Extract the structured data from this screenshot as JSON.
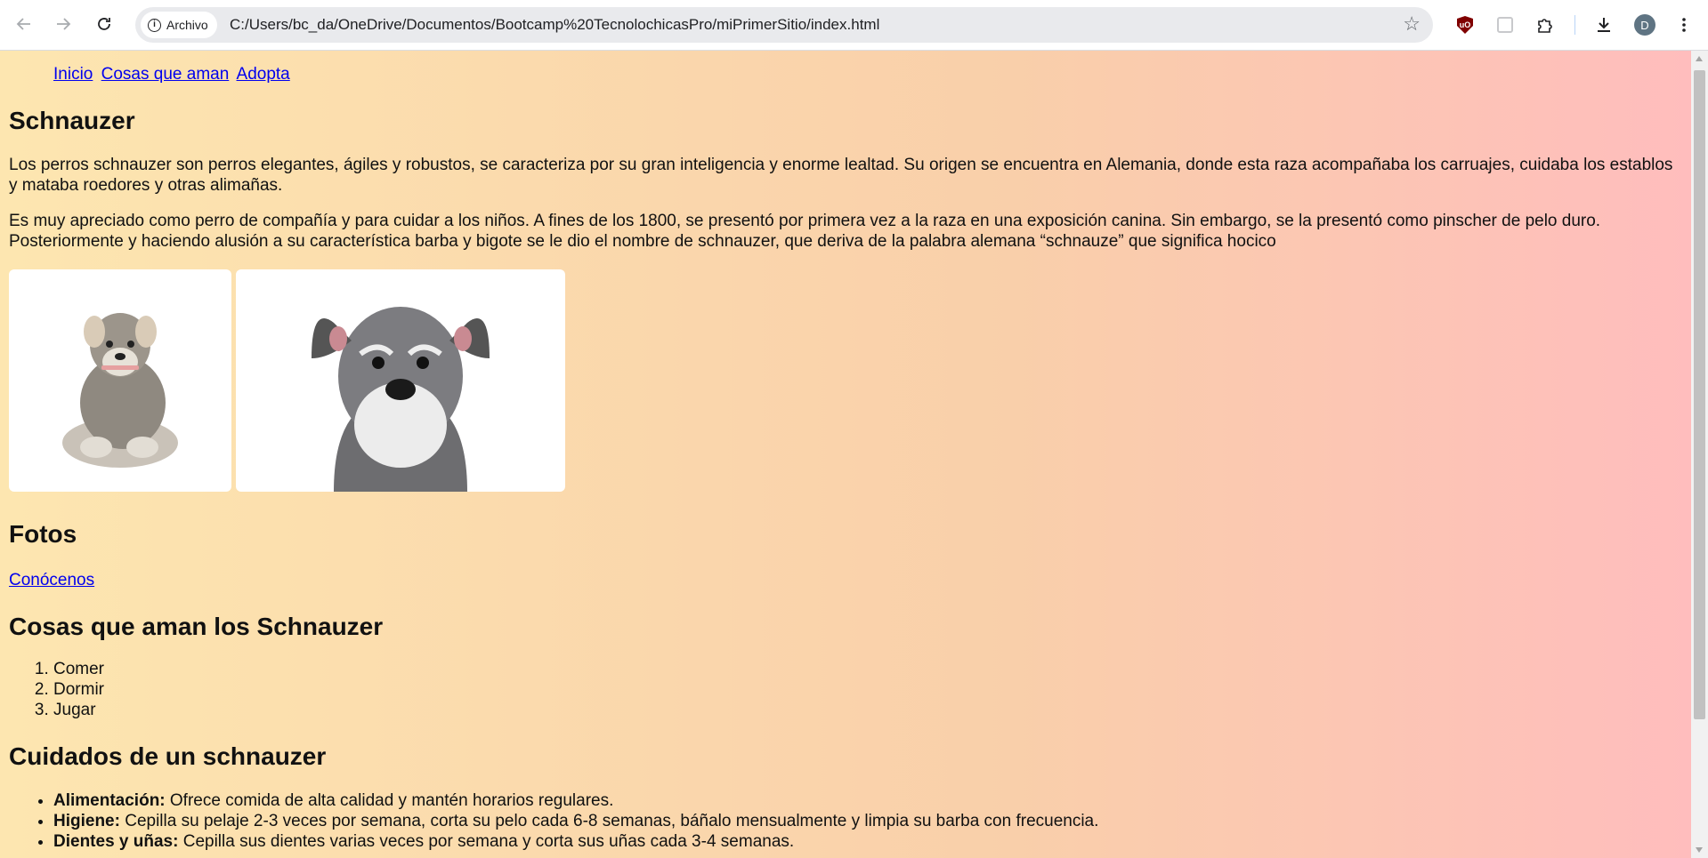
{
  "browser": {
    "chip_label": "Archivo",
    "url": "C:/Users/bc_da/OneDrive/Documentos/Bootcamp%20TecnolochicasPro/miPrimerSitio/index.html",
    "extension_ublock_label": "uO",
    "profile_initial": "D",
    "icons": [
      "back-icon",
      "forward-icon",
      "reload-icon",
      "info-icon",
      "star-icon",
      "ublock-icon",
      "extension-icon",
      "puzzle-icon",
      "download-icon",
      "menu-icon"
    ]
  },
  "page": {
    "nav": [
      "Inicio",
      "Cosas que aman",
      "Adopta"
    ],
    "breed_title": "Schnauzer",
    "paragraph1": "Los perros schnauzer son perros elegantes, ágiles y robustos, se caracteriza por su gran inteligencia y enorme lealtad. Su origen se encuentra en Alemania, donde esta raza acompañaba los carruajes, cuidaba los establos y mataba roedores y otras alimañas.",
    "paragraph2": "Es muy apreciado como perro de compañía y para cuidar a los niños. A fines de los 1800, se presentó por primera vez a la raza en una exposición canina. Sin embargo, se la presentó como pinscher de pelo duro. Posteriormente y haciendo alusión a su característica barba y bigote se le dio el nombre de schnauzer, que deriva de la palabra alemana “schnauze” que significa hocico",
    "photos_title": "Fotos",
    "conocenos_link": "Conócenos",
    "loves_title": "Cosas que aman los Schnauzer",
    "loves": [
      "Comer",
      "Dormir",
      "Jugar"
    ],
    "care_title": "Cuidados de un schnauzer",
    "care": [
      {
        "label": "Alimentación:",
        "text": " Ofrece comida de alta calidad y mantén horarios regulares."
      },
      {
        "label": "Higiene:",
        "text": " Cepilla su pelaje 2-3 veces por semana, corta su pelo cada 6-8 semanas, báñalo mensualmente y limpia su barba con frecuencia."
      },
      {
        "label": "Dientes y uñas:",
        "text": " Cepilla sus dientes varias veces por semana y corta sus uñas cada 3-4 semanas."
      }
    ]
  },
  "colors": {
    "gradient_left": "#fde6b0",
    "gradient_right": "#ffbdbd",
    "link": "#0000ee"
  }
}
